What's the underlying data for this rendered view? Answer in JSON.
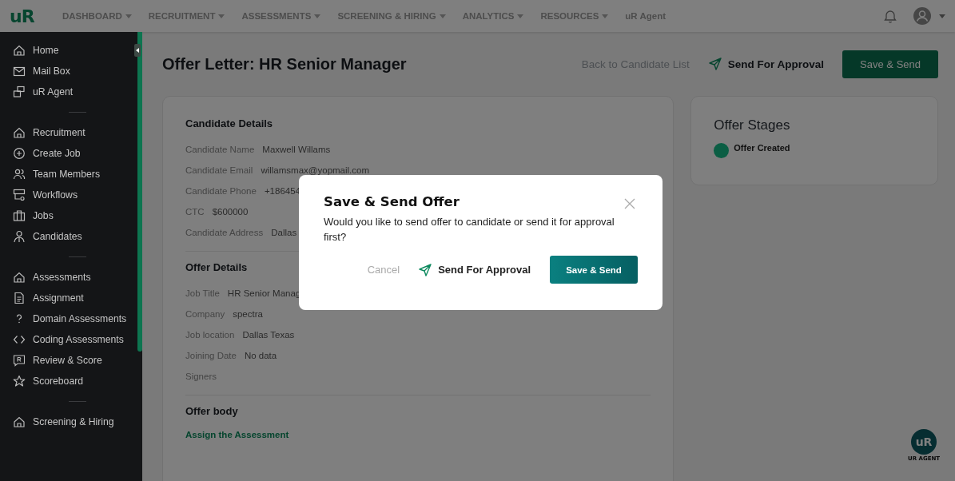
{
  "topbar": {
    "brand": "uR",
    "nav": [
      {
        "label": "DASHBOARD",
        "has_menu": true
      },
      {
        "label": "RECRUITMENT",
        "has_menu": true
      },
      {
        "label": "ASSESSMENTS",
        "has_menu": true
      },
      {
        "label": "SCREENING & HIRING",
        "has_menu": true
      },
      {
        "label": "ANALYTICS",
        "has_menu": true
      },
      {
        "label": "RESOURCES",
        "has_menu": true
      },
      {
        "label": "uR Agent",
        "has_menu": false
      }
    ]
  },
  "sidebar": {
    "groups": [
      {
        "items": [
          "Home",
          "Mail Box",
          "uR Agent"
        ]
      },
      {
        "items": [
          "Recruitment",
          "Create Job",
          "Team Members",
          "Workflows",
          "Jobs",
          "Candidates"
        ]
      },
      {
        "items": [
          "Assessments",
          "Assignment",
          "Domain Assessments",
          "Coding Assessments",
          "Review & Score",
          "Scoreboard"
        ]
      },
      {
        "items": [
          "Screening & Hiring"
        ]
      }
    ]
  },
  "page": {
    "title": "Offer Letter: HR Senior Manager",
    "back_link": "Back to Candidate List",
    "approval_button": "Send For Approval",
    "save_button": "Save & Send"
  },
  "sections": [
    {
      "title": "Candidate Details",
      "fields": [
        {
          "label": "Candidate Name",
          "value": "Maxwell Willams"
        },
        {
          "label": "Candidate Email",
          "value": "willamsmax@yopmail.com"
        },
        {
          "label": "Candidate Phone",
          "value": "+186454"
        },
        {
          "label": "CTC",
          "value": "$600000"
        },
        {
          "label": "Candidate Address",
          "value": "Dallas"
        }
      ]
    },
    {
      "title": "Offer Details",
      "fields": [
        {
          "label": "Job Title",
          "value": "HR Senior Manag"
        },
        {
          "label": "Company",
          "value": "spectra"
        },
        {
          "label": "Job location",
          "value": "Dallas Texas"
        },
        {
          "label": "Joining Date",
          "value": "No data"
        },
        {
          "label": "Signers"
        }
      ]
    },
    {
      "title": "Offer body",
      "link": "Assign the Assessment"
    }
  ],
  "stages": {
    "title": "Offer Stages",
    "items": [
      {
        "label": "Offer Created",
        "color": "#0b5e44"
      }
    ]
  },
  "agent_badge": {
    "logo": "uR",
    "caption": "UR AGENT"
  },
  "modal": {
    "title": "Save & Send Offer",
    "message": "Would you like to send offer to candidate or send it for approval first?",
    "cancel": "Cancel",
    "approval_button": "Send For Approval",
    "save_button": "Save & Send"
  }
}
